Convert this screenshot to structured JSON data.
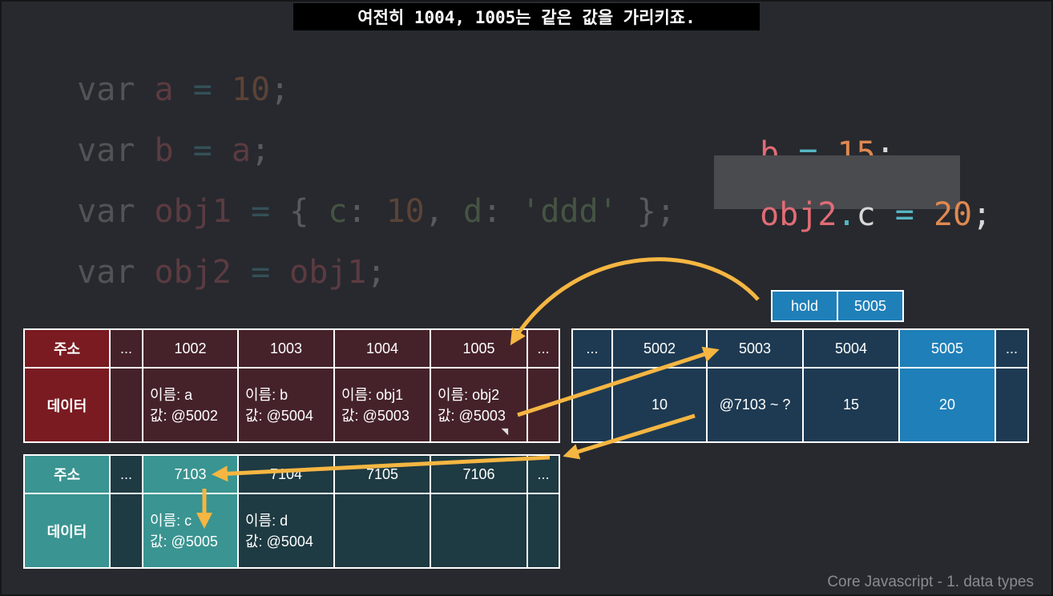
{
  "caption": "여전히 1004, 1005는 같은 값을 가리키죠.",
  "code_left": {
    "line1": [
      "var",
      " ",
      "a",
      " ",
      "=",
      " ",
      "10",
      ";"
    ],
    "line2": [
      "var",
      " ",
      "b",
      " ",
      "=",
      " ",
      "a",
      ";"
    ],
    "line3": [
      "var",
      " ",
      "obj1",
      " ",
      "=",
      " ",
      "{",
      " ",
      "c",
      ":",
      " ",
      "10",
      ",",
      " ",
      "d",
      ":",
      " ",
      "'ddd'",
      " ",
      "}",
      ";"
    ],
    "line4": [
      "var",
      " ",
      "obj2",
      " ",
      "=",
      " ",
      "obj1",
      ";"
    ]
  },
  "code_right": {
    "line1": {
      "var": "b",
      "op": "=",
      "num": "15",
      "semi": ";"
    },
    "line2": {
      "obj": "obj2",
      "dot": ".",
      "prop": "c",
      "op": "=",
      "num": "20",
      "semi": ";"
    }
  },
  "colors": {
    "background": "#27292e",
    "var_table_header": "#7a1b22",
    "var_table_cell": "#45222a",
    "data_table_cell": "#1e3a52",
    "data_table_highlight": "#1f7fb8",
    "obj_table_header": "#3a9491",
    "obj_table_cell": "#1e3a42",
    "arrow": "#f5b642"
  },
  "variable_table": {
    "row_labels": {
      "address": "주소",
      "data": "데이터"
    },
    "addresses": [
      "...",
      "1002",
      "1003",
      "1004",
      "1005",
      "..."
    ],
    "cells": [
      {
        "name": "",
        "value": ""
      },
      {
        "name": "이름: a",
        "value": "값: @5002"
      },
      {
        "name": "이름: b",
        "value": "값: @5004"
      },
      {
        "name": "이름: obj1",
        "value": "값: @5003"
      },
      {
        "name": "이름: obj2",
        "value": "값: @5003"
      },
      {
        "name": "",
        "value": ""
      }
    ]
  },
  "data_table": {
    "addresses": [
      "...",
      "5002",
      "5003",
      "5004",
      "5005",
      "..."
    ],
    "values": [
      "",
      "10",
      "@7103 ~ ?",
      "15",
      "20",
      ""
    ]
  },
  "hold": {
    "label": "hold",
    "value": "5005"
  },
  "object_table": {
    "row_labels": {
      "address": "주소",
      "data": "데이터"
    },
    "addresses": [
      "...",
      "7103",
      "7104",
      "7105",
      "7106",
      "..."
    ],
    "cells": [
      {
        "name": "",
        "value": ""
      },
      {
        "name": "이름: c",
        "value": "값: @5005"
      },
      {
        "name": "이름: d",
        "value": "값: @5004"
      },
      {
        "name": "",
        "value": ""
      },
      {
        "name": "",
        "value": ""
      },
      {
        "name": "",
        "value": ""
      }
    ]
  },
  "footer": "Core Javascript - 1. data types"
}
